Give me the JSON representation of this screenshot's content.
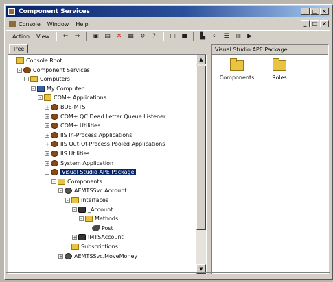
{
  "window": {
    "title": "Component Services",
    "controls": [
      "_",
      "□",
      "×"
    ]
  },
  "menubar": {
    "items": [
      "Console",
      "Window",
      "Help"
    ],
    "inner_controls": [
      "_",
      "□",
      "×"
    ]
  },
  "toolbar": {
    "action": "Action",
    "view": "View",
    "icons": [
      "back-icon",
      "forward-icon",
      "up-folder-icon",
      "show-hide-tree-icon",
      "delete-icon",
      "properties-icon",
      "refresh-icon",
      "help-icon",
      "new-window-icon",
      "stop-icon",
      "large-icons-icon",
      "small-icons-icon",
      "list-icon",
      "details-icon",
      "play-icon"
    ]
  },
  "tree": {
    "tab": "Tree",
    "nodes": [
      {
        "label": "Console Root",
        "indent": 0,
        "icon": "folder",
        "expander": ""
      },
      {
        "label": "Component Services",
        "indent": 1,
        "icon": "gear",
        "expander": "-"
      },
      {
        "label": "Computers",
        "indent": 2,
        "icon": "folder",
        "expander": "-"
      },
      {
        "label": "My Computer",
        "indent": 3,
        "icon": "pc",
        "expander": "-"
      },
      {
        "label": "COM+ Applications",
        "indent": 4,
        "icon": "folder",
        "expander": "-"
      },
      {
        "label": "BDE-MTS",
        "indent": 5,
        "icon": "gear",
        "expander": "+"
      },
      {
        "label": "COM+ QC Dead Letter Queue Listener",
        "indent": 5,
        "icon": "gear",
        "expander": "+"
      },
      {
        "label": "COM+ Utilities",
        "indent": 5,
        "icon": "gear",
        "expander": "+"
      },
      {
        "label": "IIS In-Process Applications",
        "indent": 5,
        "icon": "gear",
        "expander": "+"
      },
      {
        "label": "IIS Out-Of-Process Pooled Applications",
        "indent": 5,
        "icon": "gear",
        "expander": "+"
      },
      {
        "label": "IIS Utilities",
        "indent": 5,
        "icon": "gear",
        "expander": "+"
      },
      {
        "label": "System Application",
        "indent": 5,
        "icon": "gear",
        "expander": "+"
      },
      {
        "label": "Visual Studio APE Package",
        "indent": 5,
        "icon": "gear",
        "expander": "-",
        "selected": true
      },
      {
        "label": "Components",
        "indent": 6,
        "icon": "folder",
        "expander": "-"
      },
      {
        "label": "AEMTSSvc.Account",
        "indent": 7,
        "icon": "ball",
        "expander": "-"
      },
      {
        "label": "Interfaces",
        "indent": 8,
        "icon": "folder",
        "expander": "-"
      },
      {
        "label": "_Account",
        "indent": 9,
        "icon": "iface",
        "expander": "-"
      },
      {
        "label": "Methods",
        "indent": 10,
        "icon": "folder",
        "expander": "-"
      },
      {
        "label": "Post",
        "indent": 11,
        "icon": "method",
        "expander": ""
      },
      {
        "label": "IMTSAccount",
        "indent": 9,
        "icon": "iface",
        "expander": "+"
      },
      {
        "label": "Subscriptions",
        "indent": 8,
        "icon": "folder",
        "expander": ""
      },
      {
        "label": "AEMTSSvc.MoveMoney",
        "indent": 7,
        "icon": "ball",
        "expander": "+"
      }
    ]
  },
  "details": {
    "header": "Visual Studio APE Package",
    "items": [
      {
        "label": "Components",
        "icon": "folder-icon"
      },
      {
        "label": "Roles",
        "icon": "folder-icon"
      }
    ]
  },
  "colors": {
    "title_start": "#0a246a",
    "title_end": "#a6caf0",
    "selection": "#0a246a",
    "face": "#d4d0c8",
    "folder": "#e8c440"
  }
}
